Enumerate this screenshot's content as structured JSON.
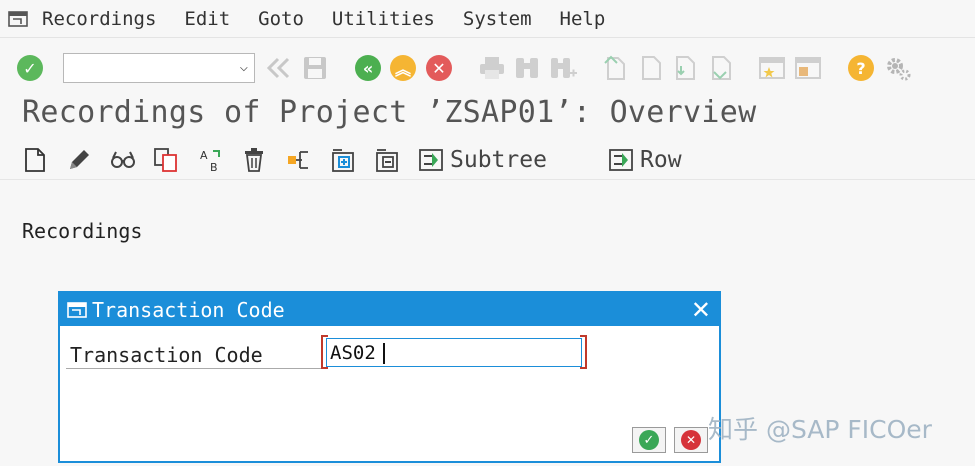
{
  "menubar": {
    "items": [
      {
        "label": "Recordings"
      },
      {
        "label": "Edit"
      },
      {
        "label": "Goto"
      },
      {
        "label": "Utilities"
      },
      {
        "label": "System"
      },
      {
        "label": "Help"
      }
    ]
  },
  "toolbar": {
    "command_field": {
      "value": "",
      "placeholder": ""
    }
  },
  "page": {
    "title": "Recordings of Project ’ZSAP01’: Overview",
    "section_label": "Recordings"
  },
  "app_toolbar": {
    "subtree_label": "Subtree",
    "row_label": "Row"
  },
  "dialog": {
    "title": "Transaction Code",
    "field_label": "Transaction Code",
    "field_value": "AS02"
  },
  "watermark": {
    "text": "知乎 @SAP FICOer"
  },
  "colors": {
    "dialog_blue": "#1b8ed9",
    "ok_green": "#3aa757",
    "cancel_red": "#d6333a",
    "nav_green": "#4caf50",
    "nav_orange": "#f5a623",
    "help_orange": "#f5a623",
    "bracket_red": "#c0392b"
  }
}
